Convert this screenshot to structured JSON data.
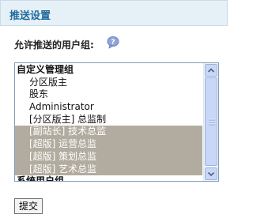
{
  "header": {
    "title": "推送设置"
  },
  "field": {
    "label": "允许推送的用户组:",
    "help_icon": "help-bubble-icon"
  },
  "listbox": {
    "options": [
      {
        "label": "自定义管理组",
        "type": "group",
        "selected": false
      },
      {
        "label": "分区版主",
        "type": "child",
        "selected": false
      },
      {
        "label": "股东",
        "type": "child",
        "selected": false
      },
      {
        "label": "Administrator",
        "type": "child",
        "selected": false
      },
      {
        "label": "[分区版主] 总监制",
        "type": "child",
        "selected": false
      },
      {
        "label": "[副站长] 技术总监",
        "type": "child",
        "selected": true
      },
      {
        "label": "[超版] 运营总监",
        "type": "child",
        "selected": true
      },
      {
        "label": "[超版] 策划总监",
        "type": "child",
        "selected": true
      },
      {
        "label": "[超版] 艺术总监",
        "type": "child",
        "selected": true
      },
      {
        "label": "系统用户组",
        "type": "group",
        "selected": false
      }
    ]
  },
  "submit": {
    "label": "提交"
  },
  "colors": {
    "header_bg": "#e6f0f7",
    "header_text": "#206a9c",
    "selected_bg": "#b1ac9f",
    "selected_text": "#ffffff"
  }
}
